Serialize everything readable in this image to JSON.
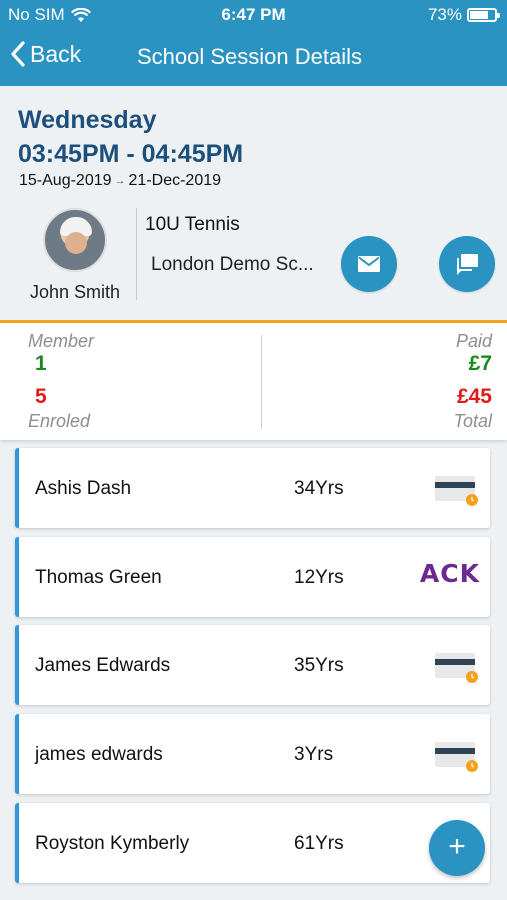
{
  "status_bar": {
    "carrier": "No SIM",
    "time": "6:47 PM",
    "battery_percent": "73%",
    "battery_level": 0.73
  },
  "nav": {
    "back_label": "Back",
    "title": "School Session Details"
  },
  "session": {
    "day": "Wednesday",
    "time_range": "03:45PM - 04:45PM",
    "start_date": "15-Aug-2019",
    "end_date": "21-Dec-2019",
    "coach_name": "John Smith",
    "group_name": "10U Tennis",
    "venue": "London Demo Sc..."
  },
  "stats": {
    "member_label": "Member",
    "member_count": "1",
    "enroled_count": "5",
    "enroled_label": "Enroled",
    "paid_label": "Paid",
    "paid_amount": "£7",
    "total_amount": "£45",
    "total_label": "Total"
  },
  "students": [
    {
      "name": "Ashis Dash",
      "age": "34Yrs",
      "payment_icon": "card-pending-icon"
    },
    {
      "name": "Thomas Green",
      "age": "12Yrs",
      "payment_icon": "ack-badge",
      "ack_text": "ACK"
    },
    {
      "name": "James Edwards",
      "age": "35Yrs",
      "payment_icon": "card-pending-icon"
    },
    {
      "name": "james edwards",
      "age": "3Yrs",
      "payment_icon": "card-pending-icon"
    },
    {
      "name": "Royston Kymberly",
      "age": "61Yrs",
      "payment_icon": "none"
    }
  ],
  "colors": {
    "primary": "#2b93c1",
    "accent_orange": "#f4a11d",
    "title_blue": "#1d4f7c",
    "green": "#1c8a1a",
    "red": "#e01b1b",
    "card_border": "#3197dc"
  },
  "fab": {
    "icon": "plus-icon",
    "label": "+"
  }
}
